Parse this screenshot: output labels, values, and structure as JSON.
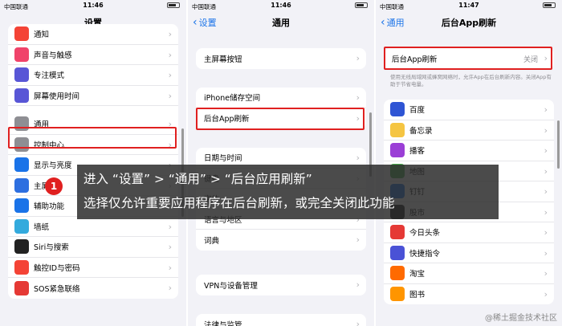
{
  "screen1": {
    "carrier": "中国联通",
    "time": "11:46",
    "title": "设置",
    "items": [
      {
        "label": "通知",
        "icon": "bell-icon",
        "color": "#f44336"
      },
      {
        "label": "声音与触感",
        "icon": "speaker-icon",
        "color": "#f0436a"
      },
      {
        "label": "专注模式",
        "icon": "moon-icon",
        "color": "#5856d6"
      },
      {
        "label": "屏幕使用时间",
        "icon": "hourglass-icon",
        "color": "#5856d6"
      },
      {
        "label": "通用",
        "icon": "gear-icon",
        "color": "#8e8e93"
      },
      {
        "label": "控制中心",
        "icon": "switches-icon",
        "color": "#8e8e93"
      },
      {
        "label": "显示与亮度",
        "icon": "text-size-icon",
        "color": "#1a73e8"
      },
      {
        "label": "主屏幕",
        "icon": "home-grid-icon",
        "color": "#2d6fe0"
      },
      {
        "label": "辅助功能",
        "icon": "accessibility-icon",
        "color": "#1a73e8"
      },
      {
        "label": "墙纸",
        "icon": "flower-icon",
        "color": "#33aadd"
      },
      {
        "label": "Siri与搜索",
        "icon": "siri-icon",
        "color": "#222222"
      },
      {
        "label": "触控ID与密码",
        "icon": "fingerprint-icon",
        "color": "#f44336"
      },
      {
        "label": "SOS紧急联络",
        "icon": "sos-icon",
        "color": "#e53935"
      }
    ]
  },
  "screen2": {
    "carrier": "中国联通",
    "time": "11:46",
    "back": "设置",
    "title": "通用",
    "group1": [
      "主屏幕按钮"
    ],
    "group2": [
      "iPhone储存空间",
      "后台App刷新"
    ],
    "group3": [
      "日期与时间",
      "键盘",
      "字体",
      "语言与地区",
      "词典"
    ],
    "group4": [
      "VPN与设备管理"
    ],
    "group5": [
      "法律与监管"
    ]
  },
  "screen3": {
    "carrier": "中国联通",
    "time": "11:47",
    "back": "通用",
    "title": "后台App刷新",
    "setting_label": "后台App刷新",
    "setting_value": "关闭",
    "description": "使用无线局域网或蜂窝网络时，允许App在后台刷新内容。关闭App有助于节省电量。",
    "apps": [
      {
        "label": "百度",
        "icon": "baidu-paw-icon",
        "color": "#2f55d4"
      },
      {
        "label": "备忘录",
        "icon": "notes-icon",
        "color": "#f5c542"
      },
      {
        "label": "播客",
        "icon": "podcast-icon",
        "color": "#9b3fd6"
      },
      {
        "label": "地图",
        "icon": "map-icon",
        "color": "#4caf50"
      },
      {
        "label": "钉钉",
        "icon": "dingtalk-icon",
        "color": "#1a73e8"
      },
      {
        "label": "股市",
        "icon": "stocks-icon",
        "color": "#111111"
      },
      {
        "label": "今日头条",
        "icon": "toutiao-icon",
        "color": "#e53935"
      },
      {
        "label": "快捷指令",
        "icon": "shortcuts-icon",
        "color": "#4a52d6"
      },
      {
        "label": "淘宝",
        "icon": "taobao-icon",
        "color": "#ff6a00"
      },
      {
        "label": "图书",
        "icon": "books-icon",
        "color": "#ff9500"
      }
    ]
  },
  "overlay": {
    "step_number": "1",
    "line1": "进入 “设置”  >  “通用”  >  “后台应用刷新”",
    "line2": "选择仅允许重要应用程序在后台刷新，或完全关闭此功能"
  },
  "watermark": "@稀土掘金技术社区"
}
